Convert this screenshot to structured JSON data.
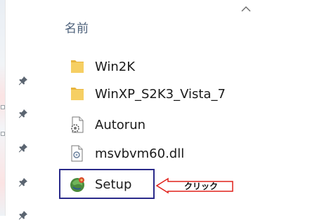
{
  "column": {
    "header": "名前"
  },
  "files": [
    {
      "name": "Win2K",
      "icon": "folder-icon"
    },
    {
      "name": "WinXP_S2K3_Vista_7",
      "icon": "folder-icon"
    },
    {
      "name": "Autorun",
      "icon": "settings-file-icon"
    },
    {
      "name": "msvbvm60.dll",
      "icon": "dll-file-icon"
    },
    {
      "name": "Setup",
      "icon": "setup-installer-icon"
    }
  ],
  "callout": {
    "text": "クリック"
  },
  "colors": {
    "folder": "#f3c857",
    "highlight_border": "#2a2a8a",
    "callout_border": "#e0201a",
    "header_text": "#4c607a"
  }
}
